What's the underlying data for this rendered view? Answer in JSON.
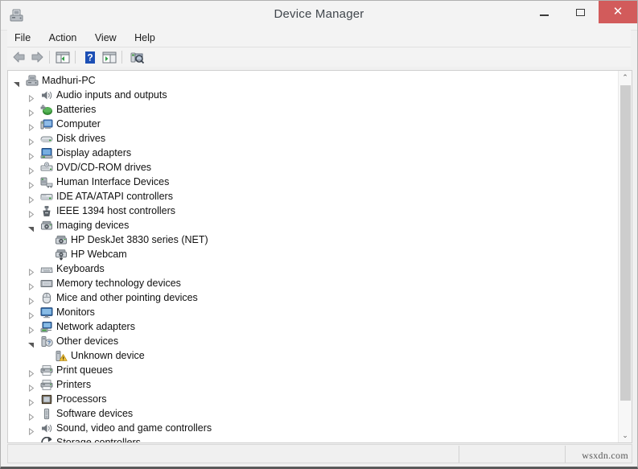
{
  "window": {
    "title": "Device Manager",
    "icon": "device-manager-icon",
    "controls": {
      "minimize": "–",
      "maximize": "□",
      "close": "✕",
      "close_color": "#d25b5b"
    }
  },
  "menubar": {
    "items": [
      {
        "label": "File"
      },
      {
        "label": "Action"
      },
      {
        "label": "View"
      },
      {
        "label": "Help"
      }
    ]
  },
  "toolbar": {
    "items": [
      {
        "name": "back-arrow-icon",
        "tooltip": "Back"
      },
      {
        "name": "forward-arrow-icon",
        "tooltip": "Forward"
      },
      {
        "name": "show-hide-console-tree-icon",
        "tooltip": "Show/Hide Console Tree"
      },
      {
        "name": "help-icon",
        "tooltip": "Help"
      },
      {
        "name": "properties-icon",
        "tooltip": "Properties"
      },
      {
        "name": "scan-for-hardware-changes-icon",
        "tooltip": "Scan for hardware changes"
      }
    ]
  },
  "tree": {
    "nodes": [
      {
        "label": "Madhuri-PC",
        "level": 0,
        "state": "expanded",
        "icon": "computer-root-icon"
      },
      {
        "label": "Audio inputs and outputs",
        "level": 1,
        "state": "collapsed",
        "icon": "speaker-icon"
      },
      {
        "label": "Batteries",
        "level": 1,
        "state": "collapsed",
        "icon": "battery-icon"
      },
      {
        "label": "Computer",
        "level": 1,
        "state": "collapsed",
        "icon": "computer-icon"
      },
      {
        "label": "Disk drives",
        "level": 1,
        "state": "collapsed",
        "icon": "disk-drive-icon"
      },
      {
        "label": "Display adapters",
        "level": 1,
        "state": "collapsed",
        "icon": "display-adapter-icon"
      },
      {
        "label": "DVD/CD-ROM drives",
        "level": 1,
        "state": "collapsed",
        "icon": "dvd-drive-icon"
      },
      {
        "label": "Human Interface Devices",
        "level": 1,
        "state": "collapsed",
        "icon": "hid-icon"
      },
      {
        "label": "IDE ATA/ATAPI controllers",
        "level": 1,
        "state": "collapsed",
        "icon": "ide-controller-icon"
      },
      {
        "label": "IEEE 1394 host controllers",
        "level": 1,
        "state": "collapsed",
        "icon": "firewire-icon"
      },
      {
        "label": "Imaging devices",
        "level": 1,
        "state": "expanded",
        "icon": "imaging-device-icon"
      },
      {
        "label": "HP DeskJet 3830 series (NET)",
        "level": 2,
        "state": "leaf",
        "icon": "imaging-device-icon"
      },
      {
        "label": "HP Webcam",
        "level": 2,
        "state": "leaf",
        "icon": "webcam-icon"
      },
      {
        "label": "Keyboards",
        "level": 1,
        "state": "collapsed",
        "icon": "keyboard-icon"
      },
      {
        "label": "Memory technology devices",
        "level": 1,
        "state": "collapsed",
        "icon": "memory-icon"
      },
      {
        "label": "Mice and other pointing devices",
        "level": 1,
        "state": "collapsed",
        "icon": "mouse-icon"
      },
      {
        "label": "Monitors",
        "level": 1,
        "state": "collapsed",
        "icon": "monitor-icon"
      },
      {
        "label": "Network adapters",
        "level": 1,
        "state": "collapsed",
        "icon": "network-adapter-icon"
      },
      {
        "label": "Other devices",
        "level": 1,
        "state": "expanded",
        "icon": "unknown-device-icon"
      },
      {
        "label": "Unknown device",
        "level": 2,
        "state": "leaf",
        "icon": "unknown-device-warning-icon"
      },
      {
        "label": "Print queues",
        "level": 1,
        "state": "collapsed",
        "icon": "printer-icon"
      },
      {
        "label": "Printers",
        "level": 1,
        "state": "collapsed",
        "icon": "printer-icon"
      },
      {
        "label": "Processors",
        "level": 1,
        "state": "collapsed",
        "icon": "processor-icon"
      },
      {
        "label": "Software devices",
        "level": 1,
        "state": "collapsed",
        "icon": "software-device-icon"
      },
      {
        "label": "Sound, video and game controllers",
        "level": 1,
        "state": "collapsed",
        "icon": "speaker-icon"
      },
      {
        "label": "Storage controllers",
        "level": 1,
        "state": "collapsed",
        "icon": "storage-controller-icon"
      }
    ]
  },
  "scrollbar": {
    "up_arrow": "⌃",
    "down_arrow": "⌄"
  },
  "statusbar": {
    "panes": [
      "",
      "",
      ""
    ],
    "watermark": "wsxdn.com"
  }
}
